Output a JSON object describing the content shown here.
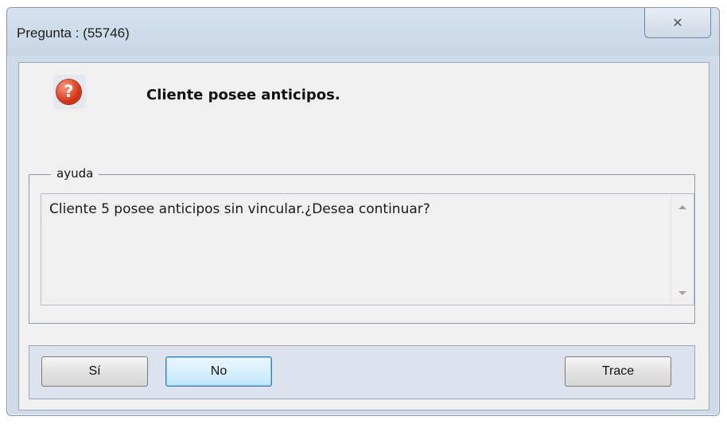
{
  "window": {
    "title": "Pregunta : (55746)",
    "close_glyph": "✕"
  },
  "message": {
    "icon": "question-icon",
    "icon_glyph": "?",
    "headline": "Cliente posee anticipos."
  },
  "help": {
    "legend": "ayuda",
    "text": "Cliente 5 posee anticipos sin vincular.¿Desea continuar?"
  },
  "buttons": {
    "yes_label": "Sí",
    "no_label": "No",
    "trace_label": "Trace"
  },
  "colors": {
    "frame": "#cfdbe8",
    "client_bg": "#f0f0f0",
    "button_bar": "#dbe2ee",
    "default_button_border": "#3c7fb1"
  }
}
